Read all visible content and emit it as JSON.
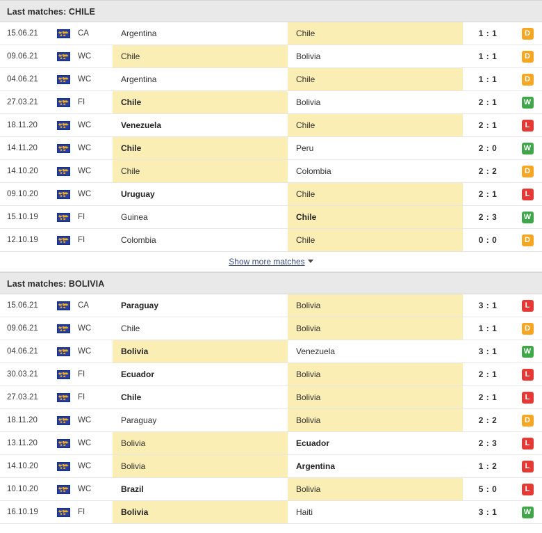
{
  "sections": [
    {
      "id": "chile",
      "title": "Last matches: CHILE",
      "focus_team": "Chile",
      "matches": [
        {
          "date": "15.06.21",
          "flag": "world-flag-icon",
          "competition": "CA",
          "home": "Argentina",
          "away": "Chile",
          "score": "1 : 1",
          "result": "D",
          "home_highlight": false,
          "away_highlight": true,
          "home_bold": false,
          "away_bold": false
        },
        {
          "date": "09.06.21",
          "flag": "world-flag-icon",
          "competition": "WC",
          "home": "Chile",
          "away": "Bolivia",
          "score": "1 : 1",
          "result": "D",
          "home_highlight": true,
          "away_highlight": false,
          "home_bold": false,
          "away_bold": false
        },
        {
          "date": "04.06.21",
          "flag": "world-flag-icon",
          "competition": "WC",
          "home": "Argentina",
          "away": "Chile",
          "score": "1 : 1",
          "result": "D",
          "home_highlight": false,
          "away_highlight": true,
          "home_bold": false,
          "away_bold": false
        },
        {
          "date": "27.03.21",
          "flag": "world-flag-icon",
          "competition": "FI",
          "home": "Chile",
          "away": "Bolivia",
          "score": "2 : 1",
          "result": "W",
          "home_highlight": true,
          "away_highlight": false,
          "home_bold": true,
          "away_bold": false
        },
        {
          "date": "18.11.20",
          "flag": "world-flag-icon",
          "competition": "WC",
          "home": "Venezuela",
          "away": "Chile",
          "score": "2 : 1",
          "result": "L",
          "home_highlight": false,
          "away_highlight": true,
          "home_bold": true,
          "away_bold": false
        },
        {
          "date": "14.11.20",
          "flag": "world-flag-icon",
          "competition": "WC",
          "home": "Chile",
          "away": "Peru",
          "score": "2 : 0",
          "result": "W",
          "home_highlight": true,
          "away_highlight": false,
          "home_bold": true,
          "away_bold": false
        },
        {
          "date": "14.10.20",
          "flag": "world-flag-icon",
          "competition": "WC",
          "home": "Chile",
          "away": "Colombia",
          "score": "2 : 2",
          "result": "D",
          "home_highlight": true,
          "away_highlight": false,
          "home_bold": false,
          "away_bold": false
        },
        {
          "date": "09.10.20",
          "flag": "world-flag-icon",
          "competition": "WC",
          "home": "Uruguay",
          "away": "Chile",
          "score": "2 : 1",
          "result": "L",
          "home_highlight": false,
          "away_highlight": true,
          "home_bold": true,
          "away_bold": false
        },
        {
          "date": "15.10.19",
          "flag": "world-flag-icon",
          "competition": "FI",
          "home": "Guinea",
          "away": "Chile",
          "score": "2 : 3",
          "result": "W",
          "home_highlight": false,
          "away_highlight": true,
          "home_bold": false,
          "away_bold": true
        },
        {
          "date": "12.10.19",
          "flag": "world-flag-icon",
          "competition": "FI",
          "home": "Colombia",
          "away": "Chile",
          "score": "0 : 0",
          "result": "D",
          "home_highlight": false,
          "away_highlight": true,
          "home_bold": false,
          "away_bold": false
        }
      ],
      "show_more_label": "Show more matches"
    },
    {
      "id": "bolivia",
      "title": "Last matches: BOLIVIA",
      "focus_team": "Bolivia",
      "matches": [
        {
          "date": "15.06.21",
          "flag": "world-flag-icon",
          "competition": "CA",
          "home": "Paraguay",
          "away": "Bolivia",
          "score": "3 : 1",
          "result": "L",
          "home_highlight": false,
          "away_highlight": true,
          "home_bold": true,
          "away_bold": false
        },
        {
          "date": "09.06.21",
          "flag": "world-flag-icon",
          "competition": "WC",
          "home": "Chile",
          "away": "Bolivia",
          "score": "1 : 1",
          "result": "D",
          "home_highlight": false,
          "away_highlight": true,
          "home_bold": false,
          "away_bold": false
        },
        {
          "date": "04.06.21",
          "flag": "world-flag-icon",
          "competition": "WC",
          "home": "Bolivia",
          "away": "Venezuela",
          "score": "3 : 1",
          "result": "W",
          "home_highlight": true,
          "away_highlight": false,
          "home_bold": true,
          "away_bold": false
        },
        {
          "date": "30.03.21",
          "flag": "world-flag-icon",
          "competition": "FI",
          "home": "Ecuador",
          "away": "Bolivia",
          "score": "2 : 1",
          "result": "L",
          "home_highlight": false,
          "away_highlight": true,
          "home_bold": true,
          "away_bold": false
        },
        {
          "date": "27.03.21",
          "flag": "world-flag-icon",
          "competition": "FI",
          "home": "Chile",
          "away": "Bolivia",
          "score": "2 : 1",
          "result": "L",
          "home_highlight": false,
          "away_highlight": true,
          "home_bold": true,
          "away_bold": false
        },
        {
          "date": "18.11.20",
          "flag": "world-flag-icon",
          "competition": "WC",
          "home": "Paraguay",
          "away": "Bolivia",
          "score": "2 : 2",
          "result": "D",
          "home_highlight": false,
          "away_highlight": true,
          "home_bold": false,
          "away_bold": false
        },
        {
          "date": "13.11.20",
          "flag": "world-flag-icon",
          "competition": "WC",
          "home": "Bolivia",
          "away": "Ecuador",
          "score": "2 : 3",
          "result": "L",
          "home_highlight": true,
          "away_highlight": false,
          "home_bold": false,
          "away_bold": true
        },
        {
          "date": "14.10.20",
          "flag": "world-flag-icon",
          "competition": "WC",
          "home": "Bolivia",
          "away": "Argentina",
          "score": "1 : 2",
          "result": "L",
          "home_highlight": true,
          "away_highlight": false,
          "home_bold": false,
          "away_bold": true
        },
        {
          "date": "10.10.20",
          "flag": "world-flag-icon",
          "competition": "WC",
          "home": "Brazil",
          "away": "Bolivia",
          "score": "5 : 0",
          "result": "L",
          "home_highlight": false,
          "away_highlight": true,
          "home_bold": true,
          "away_bold": false
        },
        {
          "date": "16.10.19",
          "flag": "world-flag-icon",
          "competition": "FI",
          "home": "Bolivia",
          "away": "Haiti",
          "score": "3 : 1",
          "result": "W",
          "home_highlight": true,
          "away_highlight": false,
          "home_bold": true,
          "away_bold": false
        }
      ]
    }
  ],
  "colors": {
    "highlight": "#fbeeb4",
    "header_bg": "#e9e9e9",
    "win": "#3fa64a",
    "draw": "#f5a623",
    "loss": "#e53935",
    "link": "#3a4a7a"
  }
}
